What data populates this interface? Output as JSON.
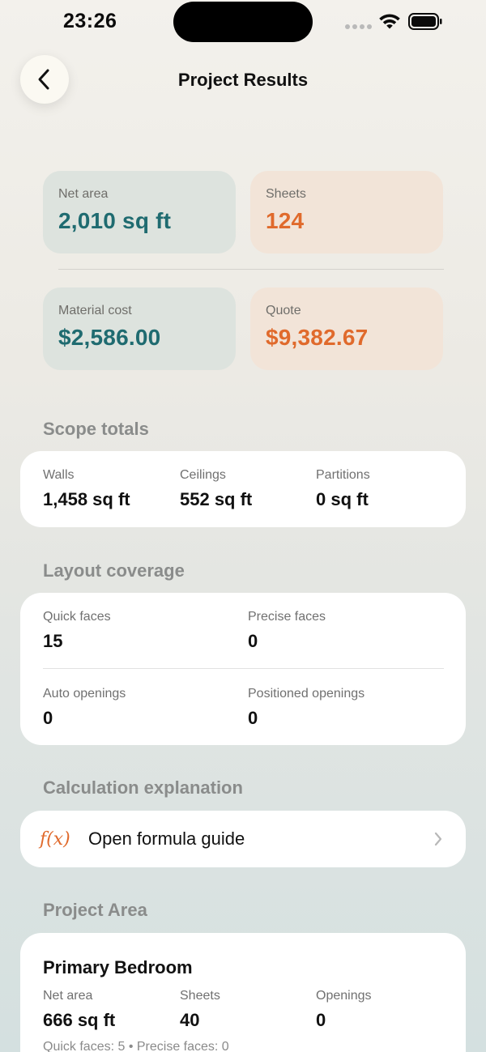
{
  "status": {
    "time": "23:26"
  },
  "header": {
    "title": "Project Results",
    "back_icon": "chevron-left-icon"
  },
  "summary": {
    "net_area": {
      "label": "Net area",
      "value": "2,010 sq ft"
    },
    "sheets": {
      "label": "Sheets",
      "value": "124"
    },
    "material_cost": {
      "label": "Material cost",
      "value": "$2,586.00"
    },
    "quote": {
      "label": "Quote",
      "value": "$9,382.67"
    }
  },
  "scope_totals": {
    "title": "Scope totals",
    "walls": {
      "label": "Walls",
      "value": "1,458 sq ft"
    },
    "ceilings": {
      "label": "Ceilings",
      "value": "552 sq ft"
    },
    "partitions": {
      "label": "Partitions",
      "value": "0 sq ft"
    }
  },
  "layout_coverage": {
    "title": "Layout coverage",
    "quick_faces": {
      "label": "Quick faces",
      "value": "15"
    },
    "precise_faces": {
      "label": "Precise faces",
      "value": "0"
    },
    "auto_openings": {
      "label": "Auto openings",
      "value": "0"
    },
    "positioned_openings": {
      "label": "Positioned openings",
      "value": "0"
    }
  },
  "calculation": {
    "title": "Calculation explanation",
    "icon_text": "f(x)",
    "link_label": "Open formula guide"
  },
  "project_area": {
    "title": "Project Area",
    "room": {
      "name": "Primary Bedroom",
      "net_area": {
        "label": "Net area",
        "value": "666 sq ft"
      },
      "sheets": {
        "label": "Sheets",
        "value": "40"
      },
      "openings": {
        "label": "Openings",
        "value": "0"
      },
      "meta": "Quick faces: 5 • Precise faces: 0"
    }
  },
  "colors": {
    "teal": "#1f6b70",
    "orange": "#e06a2c"
  }
}
